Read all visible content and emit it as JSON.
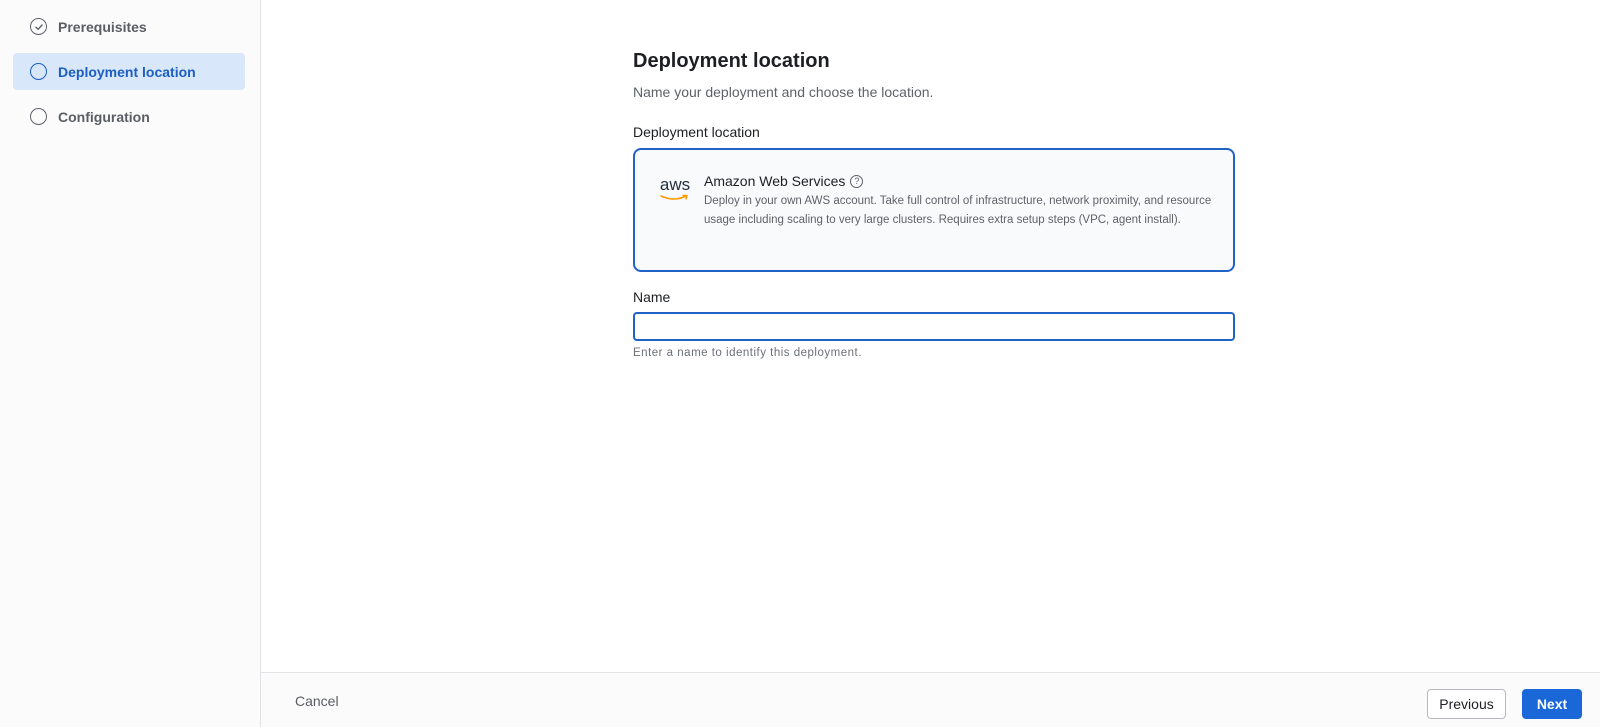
{
  "sidebar": {
    "steps": [
      {
        "label": "Prerequisites",
        "state": "completed"
      },
      {
        "label": "Deployment location",
        "state": "active"
      },
      {
        "label": "Configuration",
        "state": "pending"
      }
    ]
  },
  "main": {
    "title": "Deployment location",
    "subtitle": "Name your deployment and choose the location.",
    "location_label": "Deployment location",
    "card": {
      "logo_text": "aws",
      "title": "Amazon Web Services",
      "help_icon": "?",
      "description": "Deploy in your own AWS account. Take full control of infrastructure, network proximity, and resource usage including scaling to very large clusters. Requires extra setup steps (VPC, agent install)."
    },
    "name_label": "Name",
    "name_value": "",
    "name_helper": "Enter a name to identify this deployment."
  },
  "footer": {
    "cancel_label": "Cancel",
    "previous_label": "Previous",
    "next_label": "Next"
  },
  "colors": {
    "accent": "#1a68d8",
    "active_step_bg": "#d9e7fa",
    "aws_orange": "#ff9900"
  }
}
